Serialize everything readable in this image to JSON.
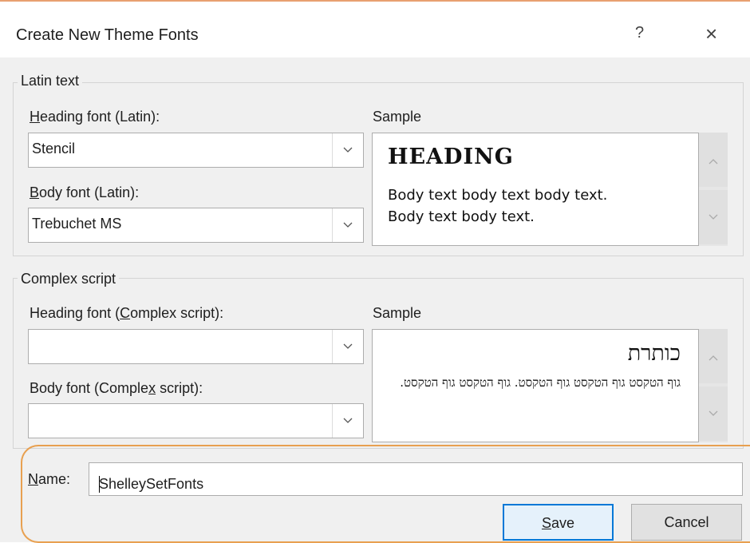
{
  "dialog": {
    "title": "Create New Theme Fonts",
    "help_glyph": "?",
    "close_glyph": "×"
  },
  "latin": {
    "group_label": "Latin text",
    "heading_label_key": "H",
    "heading_label_rest": "eading font (Latin):",
    "heading_value": "Stencil",
    "body_label_key": "B",
    "body_label_rest": "ody font (Latin):",
    "body_value": "Trebuchet MS",
    "sample_label": "Sample",
    "sample_heading": "HEADING",
    "sample_body_line1": "Body text body text body text.",
    "sample_body_line2": "Body text body text."
  },
  "complex": {
    "group_label": "Complex script",
    "heading_label_pre": "Heading font (",
    "heading_label_key": "C",
    "heading_label_post": "omplex script):",
    "heading_value": "",
    "body_label_pre": "Body font (Comple",
    "body_label_key": "x",
    "body_label_post": " script):",
    "body_value": "",
    "sample_label": "Sample",
    "sample_heading": "כותרת",
    "sample_body": "גוף הטקסט גוף הטקסט גוף הטקסט. גוף הטקסט גוף הטקסט."
  },
  "name": {
    "label_key": "N",
    "label_rest": "ame:",
    "value": "ShelleySetFonts"
  },
  "buttons": {
    "save_key": "S",
    "save_rest": "ave",
    "cancel": "Cancel"
  },
  "colors": {
    "highlight_ring": "#e8a050",
    "focus_border": "#0078d7"
  }
}
